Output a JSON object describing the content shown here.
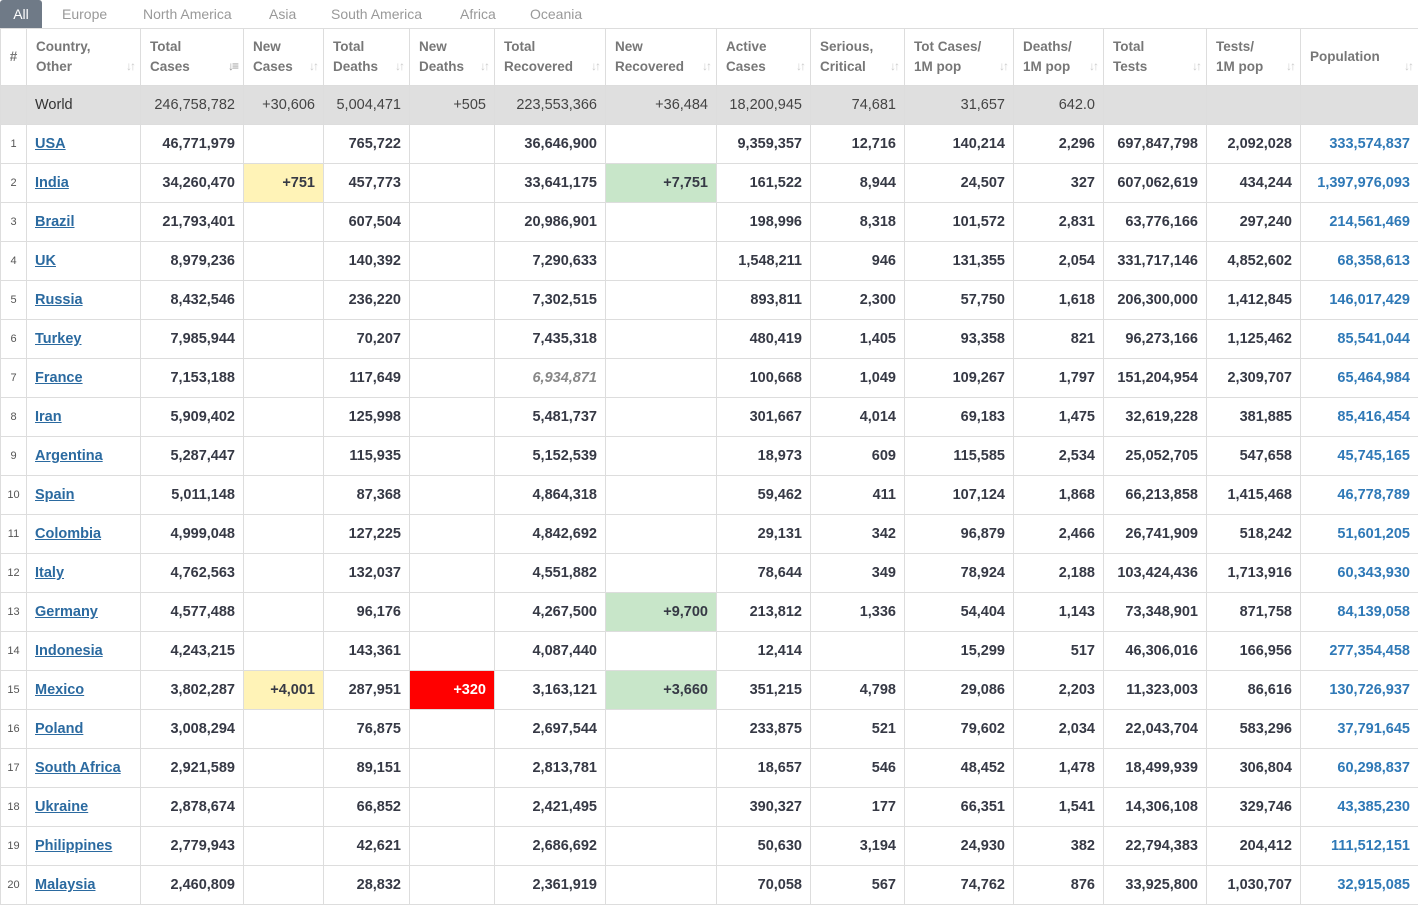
{
  "tabs": [
    "All",
    "Europe",
    "North America",
    "Asia",
    "South America",
    "Africa",
    "Oceania"
  ],
  "columns": [
    {
      "l1": "#",
      "l2": ""
    },
    {
      "l1": "Country,",
      "l2": "Other"
    },
    {
      "l1": "Total",
      "l2": "Cases"
    },
    {
      "l1": "New",
      "l2": "Cases"
    },
    {
      "l1": "Total",
      "l2": "Deaths"
    },
    {
      "l1": "New",
      "l2": "Deaths"
    },
    {
      "l1": "Total",
      "l2": "Recovered"
    },
    {
      "l1": "New",
      "l2": "Recovered"
    },
    {
      "l1": "Active",
      "l2": "Cases"
    },
    {
      "l1": "Serious,",
      "l2": "Critical"
    },
    {
      "l1": "Tot Cases/",
      "l2": "1M pop"
    },
    {
      "l1": "Deaths/",
      "l2": "1M pop"
    },
    {
      "l1": "Total",
      "l2": "Tests"
    },
    {
      "l1": "Tests/",
      "l2": "1M pop"
    },
    {
      "l1": "Population",
      "l2": ""
    }
  ],
  "world": [
    "",
    "World",
    "246,758,782",
    "+30,606",
    "5,004,471",
    "+505",
    "223,553,366",
    "+36,484",
    "18,200,945",
    "74,681",
    "31,657",
    "642.0",
    "",
    "",
    ""
  ],
  "rows": [
    [
      "1",
      "USA",
      "46,771,979",
      "",
      "765,722",
      "",
      "36,646,900",
      "",
      "9,359,357",
      "12,716",
      "140,214",
      "2,296",
      "697,847,798",
      "2,092,028",
      "333,574,837"
    ],
    [
      "2",
      "India",
      "34,260,470",
      "+751",
      "457,773",
      "",
      "33,641,175",
      "+7,751",
      "161,522",
      "8,944",
      "24,507",
      "327",
      "607,062,619",
      "434,244",
      "1,397,976,093"
    ],
    [
      "3",
      "Brazil",
      "21,793,401",
      "",
      "607,504",
      "",
      "20,986,901",
      "",
      "198,996",
      "8,318",
      "101,572",
      "2,831",
      "63,776,166",
      "297,240",
      "214,561,469"
    ],
    [
      "4",
      "UK",
      "8,979,236",
      "",
      "140,392",
      "",
      "7,290,633",
      "",
      "1,548,211",
      "946",
      "131,355",
      "2,054",
      "331,717,146",
      "4,852,602",
      "68,358,613"
    ],
    [
      "5",
      "Russia",
      "8,432,546",
      "",
      "236,220",
      "",
      "7,302,515",
      "",
      "893,811",
      "2,300",
      "57,750",
      "1,618",
      "206,300,000",
      "1,412,845",
      "146,017,429"
    ],
    [
      "6",
      "Turkey",
      "7,985,944",
      "",
      "70,207",
      "",
      "7,435,318",
      "",
      "480,419",
      "1,405",
      "93,358",
      "821",
      "96,273,166",
      "1,125,462",
      "85,541,044"
    ],
    [
      "7",
      "France",
      "7,153,188",
      "",
      "117,649",
      "",
      "6,934,871",
      "",
      "100,668",
      "1,049",
      "109,267",
      "1,797",
      "151,204,954",
      "2,309,707",
      "65,464,984"
    ],
    [
      "8",
      "Iran",
      "5,909,402",
      "",
      "125,998",
      "",
      "5,481,737",
      "",
      "301,667",
      "4,014",
      "69,183",
      "1,475",
      "32,619,228",
      "381,885",
      "85,416,454"
    ],
    [
      "9",
      "Argentina",
      "5,287,447",
      "",
      "115,935",
      "",
      "5,152,539",
      "",
      "18,973",
      "609",
      "115,585",
      "2,534",
      "25,052,705",
      "547,658",
      "45,745,165"
    ],
    [
      "10",
      "Spain",
      "5,011,148",
      "",
      "87,368",
      "",
      "4,864,318",
      "",
      "59,462",
      "411",
      "107,124",
      "1,868",
      "66,213,858",
      "1,415,468",
      "46,778,789"
    ],
    [
      "11",
      "Colombia",
      "4,999,048",
      "",
      "127,225",
      "",
      "4,842,692",
      "",
      "29,131",
      "342",
      "96,879",
      "2,466",
      "26,741,909",
      "518,242",
      "51,601,205"
    ],
    [
      "12",
      "Italy",
      "4,762,563",
      "",
      "132,037",
      "",
      "4,551,882",
      "",
      "78,644",
      "349",
      "78,924",
      "2,188",
      "103,424,436",
      "1,713,916",
      "60,343,930"
    ],
    [
      "13",
      "Germany",
      "4,577,488",
      "",
      "96,176",
      "",
      "4,267,500",
      "+9,700",
      "213,812",
      "1,336",
      "54,404",
      "1,143",
      "73,348,901",
      "871,758",
      "84,139,058"
    ],
    [
      "14",
      "Indonesia",
      "4,243,215",
      "",
      "143,361",
      "",
      "4,087,440",
      "",
      "12,414",
      "",
      "15,299",
      "517",
      "46,306,016",
      "166,956",
      "277,354,458"
    ],
    [
      "15",
      "Mexico",
      "3,802,287",
      "+4,001",
      "287,951",
      "+320",
      "3,163,121",
      "+3,660",
      "351,215",
      "4,798",
      "29,086",
      "2,203",
      "11,323,003",
      "86,616",
      "130,726,937"
    ],
    [
      "16",
      "Poland",
      "3,008,294",
      "",
      "76,875",
      "",
      "2,697,544",
      "",
      "233,875",
      "521",
      "79,602",
      "2,034",
      "22,043,704",
      "583,296",
      "37,791,645"
    ],
    [
      "17",
      "South Africa",
      "2,921,589",
      "",
      "89,151",
      "",
      "2,813,781",
      "",
      "18,657",
      "546",
      "48,452",
      "1,478",
      "18,499,939",
      "306,804",
      "60,298,837"
    ],
    [
      "18",
      "Ukraine",
      "2,878,674",
      "",
      "66,852",
      "",
      "2,421,495",
      "",
      "390,327",
      "177",
      "66,351",
      "1,541",
      "14,306,108",
      "329,746",
      "43,385,230"
    ],
    [
      "19",
      "Philippines",
      "2,779,943",
      "",
      "42,621",
      "",
      "2,686,692",
      "",
      "50,630",
      "3,194",
      "24,930",
      "382",
      "22,794,383",
      "204,412",
      "111,512,151"
    ],
    [
      "20",
      "Malaysia",
      "2,460,809",
      "",
      "28,832",
      "",
      "2,361,919",
      "",
      "70,058",
      "567",
      "74,762",
      "876",
      "33,925,800",
      "1,030,707",
      "32,915,085"
    ]
  ],
  "highlights": {
    "yellow": [
      "1:3",
      "14:3"
    ],
    "green": [
      "1:7",
      "12:7",
      "14:7"
    ],
    "red": [
      "14:5"
    ],
    "italic": [
      "6:6"
    ]
  },
  "colors": {
    "tab_active": "#6f7a87",
    "link": "#2b6aa0",
    "population": "#2f79b7",
    "new_cases": "#fff3b7",
    "new_recovered": "#c8e6c9",
    "new_deaths": "#ff0000"
  }
}
